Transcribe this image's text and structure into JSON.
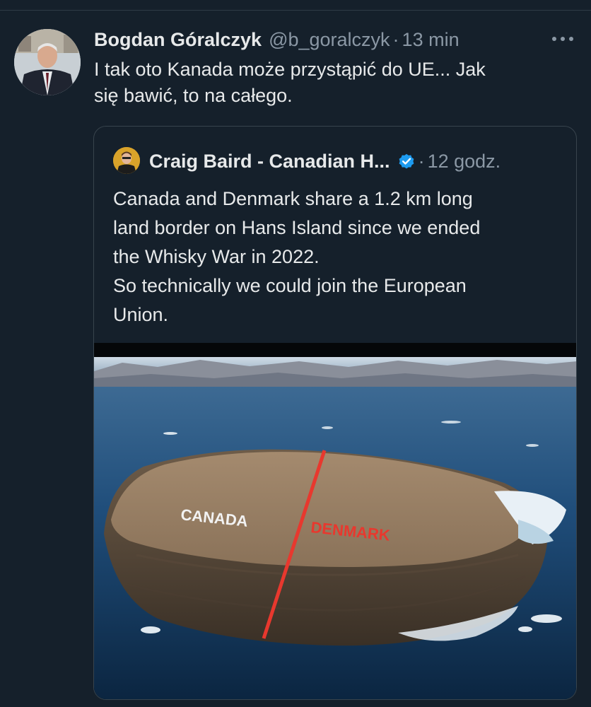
{
  "tweet": {
    "author_name": "Bogdan Góralczyk",
    "author_handle": "@b_goralczyk",
    "separator": "·",
    "time": "13 min",
    "text": "I tak oto Kanada może przystąpić do UE... Jak\nsię bawić, to na całego.",
    "more_icon": "more-dots-icon"
  },
  "quoted_tweet": {
    "author_name": "Craig Baird - Canadian H...",
    "verified_icon": "verified-badge-icon",
    "verified_color": "#1d9bf0",
    "separator": "·",
    "time": "12 godz.",
    "text": "Canada and Denmark share a 1.2 km long\nland border on Hans Island since we ended\nthe Whisky War in 2022.\nSo technically we could join the European\nUnion.",
    "image": {
      "label_left": "CANADA",
      "label_right": "DENMARK",
      "border_line_color": "#e8382e"
    }
  },
  "colors": {
    "background": "#15202b",
    "text_primary": "#e7e9ea",
    "text_secondary": "#8b98a5",
    "border": "#38444d"
  }
}
